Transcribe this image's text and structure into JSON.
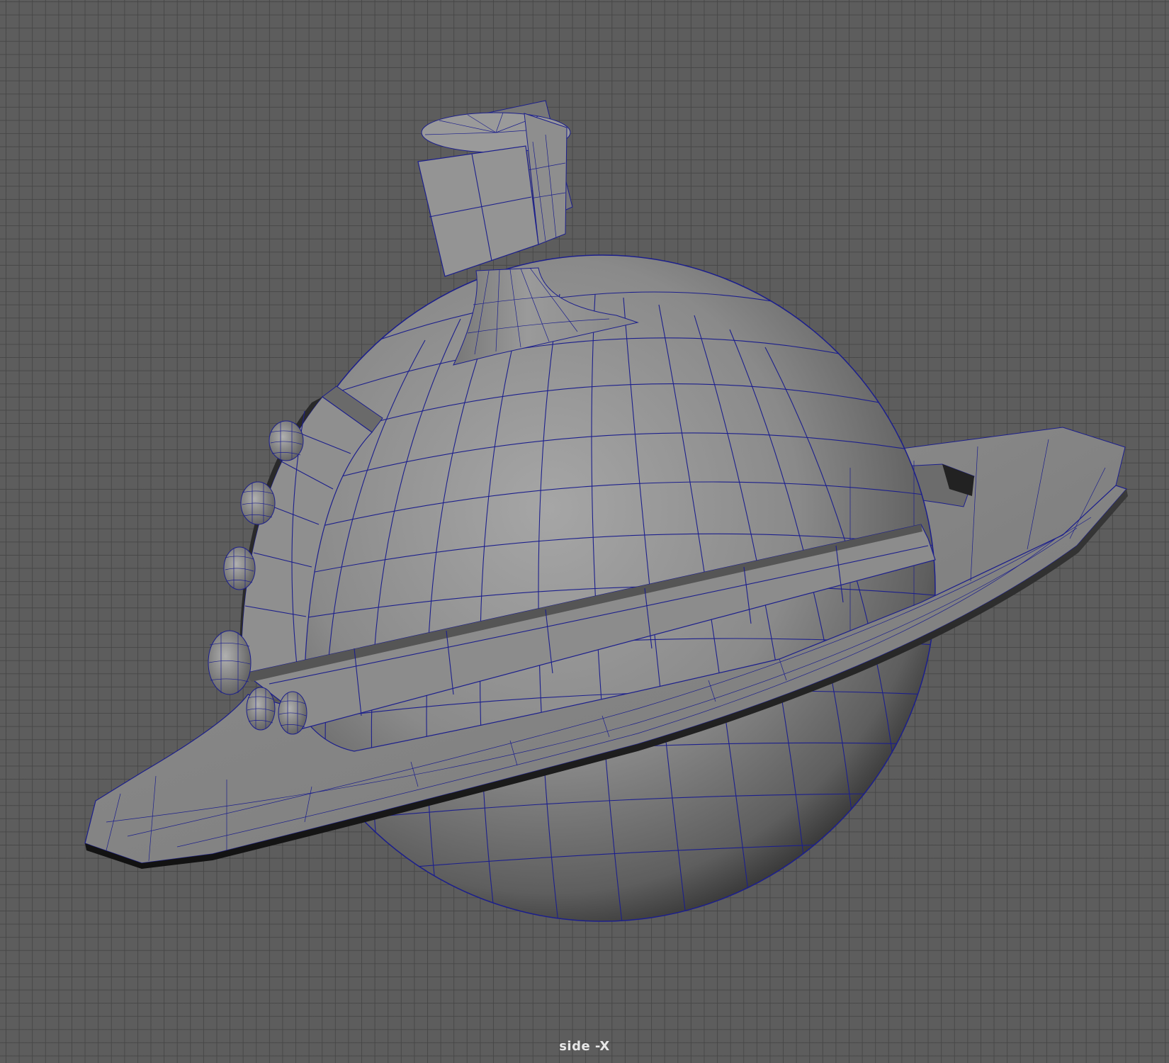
{
  "viewport": {
    "camera_label": "side -X",
    "background_color": "#5d5d5d",
    "grid_color": "#464646",
    "wireframe_color": "#1c1f8c",
    "shaded_color": "#8a8a8a",
    "display_mode": "wireframe-on-shaded"
  },
  "scene": {
    "model": "ringed-planet-ship",
    "parts": [
      "planet-sphere",
      "ring",
      "equator-band",
      "funnel-neck",
      "top-block",
      "side-panel",
      "small-spheres"
    ]
  }
}
